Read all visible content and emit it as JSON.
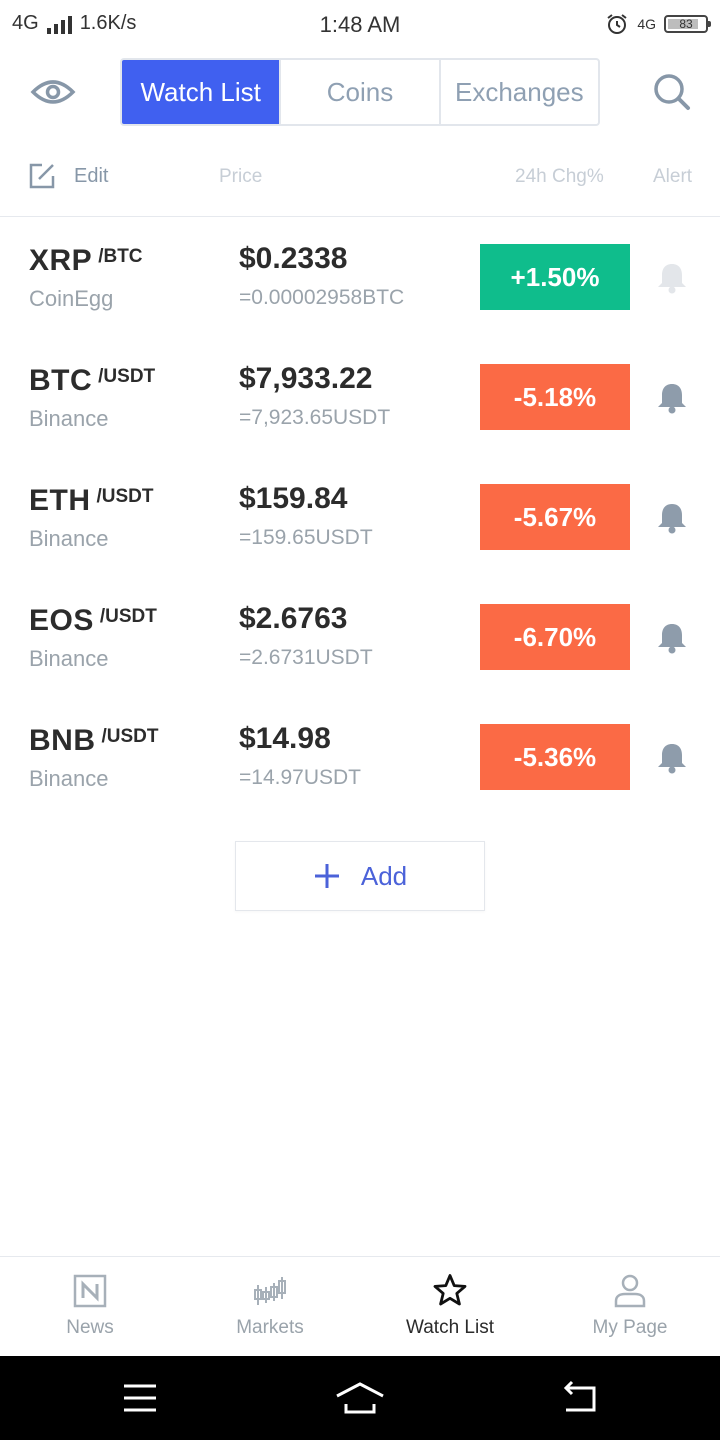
{
  "status_bar": {
    "network": "4G",
    "speed": "1.6K/s",
    "time": "1:48 AM",
    "network_right": "4G",
    "battery": "83"
  },
  "header": {
    "tabs": [
      "Watch List",
      "Coins",
      "Exchanges"
    ],
    "active_tab": "Watch List"
  },
  "columns": {
    "edit": "Edit",
    "price": "Price",
    "change": "24h Chg%",
    "alert": "Alert"
  },
  "rows": [
    {
      "base": "XRP",
      "quote": "/BTC",
      "exchange": "CoinEgg",
      "price": "$0.2338",
      "converted": "=0.00002958BTC",
      "change": "+1.50%",
      "direction": "up",
      "alert_active": false
    },
    {
      "base": "BTC",
      "quote": "/USDT",
      "exchange": "Binance",
      "price": "$7,933.22",
      "converted": "=7,923.65USDT",
      "change": "-5.18%",
      "direction": "down",
      "alert_active": true
    },
    {
      "base": "ETH",
      "quote": "/USDT",
      "exchange": "Binance",
      "price": "$159.84",
      "converted": "=159.65USDT",
      "change": "-5.67%",
      "direction": "down",
      "alert_active": true
    },
    {
      "base": "EOS",
      "quote": "/USDT",
      "exchange": "Binance",
      "price": "$2.6763",
      "converted": "=2.6731USDT",
      "change": "-6.70%",
      "direction": "down",
      "alert_active": true
    },
    {
      "base": "BNB",
      "quote": "/USDT",
      "exchange": "Binance",
      "price": "$14.98",
      "converted": "=14.97USDT",
      "change": "-5.36%",
      "direction": "down",
      "alert_active": true
    }
  ],
  "add_button": "Add",
  "bottom_nav": [
    {
      "label": "News",
      "icon": "news-icon"
    },
    {
      "label": "Markets",
      "icon": "candlestick-icon"
    },
    {
      "label": "Watch List",
      "icon": "star-icon",
      "active": true
    },
    {
      "label": "My Page",
      "icon": "user-icon"
    }
  ],
  "colors": {
    "accent": "#4060f0",
    "up": "#0fbd8c",
    "down": "#fb6a45",
    "bell_active": "#8e9cab",
    "bell_inactive": "#e3e6ea"
  }
}
